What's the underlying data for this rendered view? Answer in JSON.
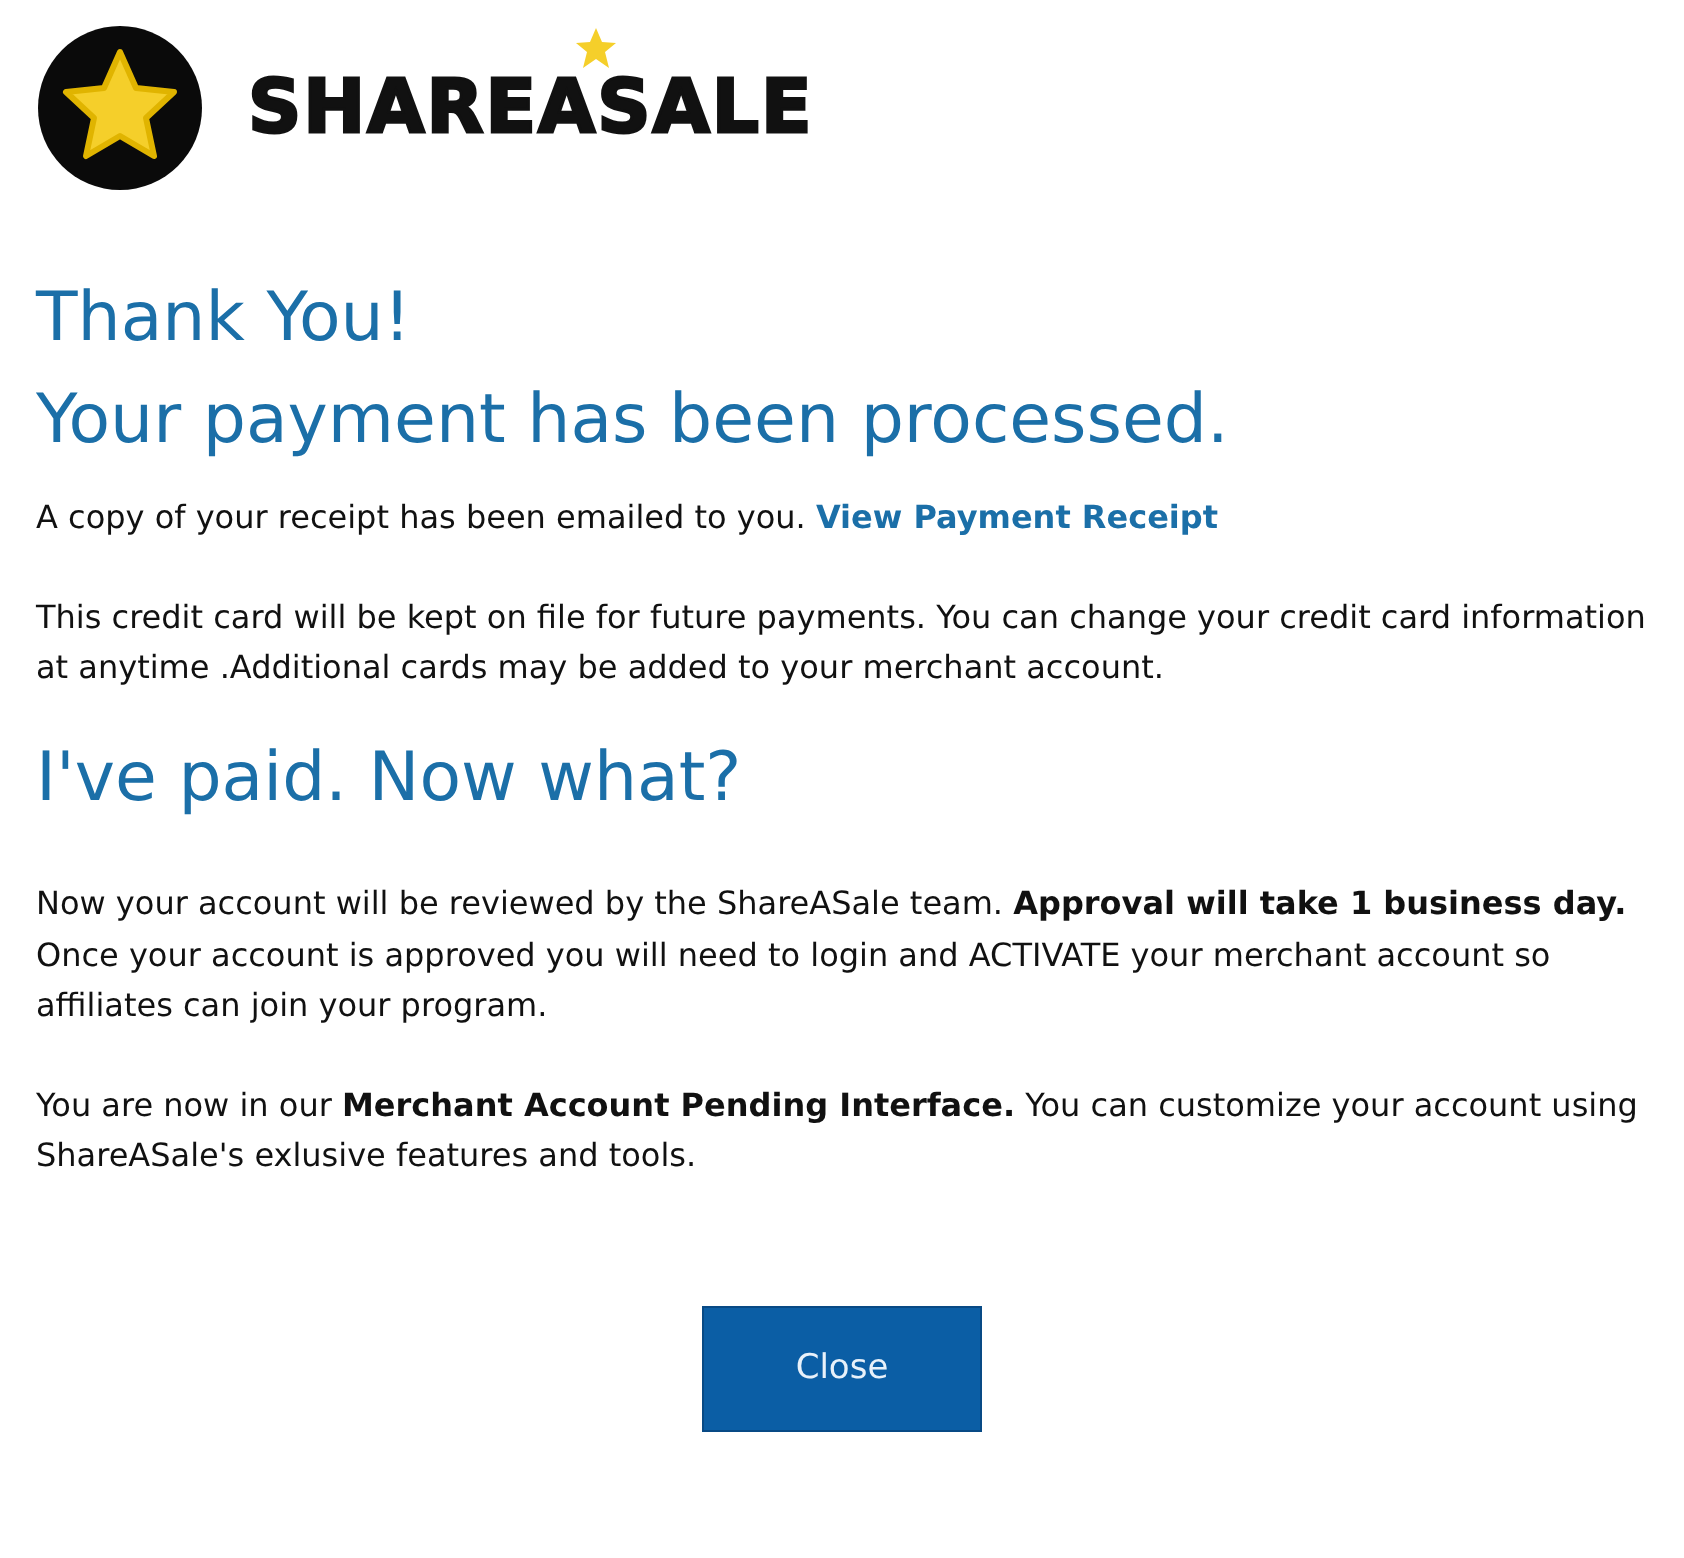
{
  "logo": {
    "wordmark": "SHAREASALE"
  },
  "title_lines": [
    "Thank You!",
    "Your payment has been processed."
  ],
  "receipt_note": {
    "text": "A copy of your receipt has been emailed to you.",
    "link": "View Payment Receipt"
  },
  "card_note": "This credit card will be kept on file for future payments. You can change your credit card information at anytime .Additional cards may be added to your merchant account.",
  "subheading": "I've paid. Now what?",
  "paragraphs": [
    "Now your account will be reviewed by the ShareASale team. **Approval will take 1 business day.** Once your account is approved you will need to login and ACTIVATE your merchant account so affiliates can join your program.",
    "You are now in our **Merchant Account Pending Interface.** You can customize your account using ShareASale's exlusive features and tools."
  ],
  "button": "Close"
}
